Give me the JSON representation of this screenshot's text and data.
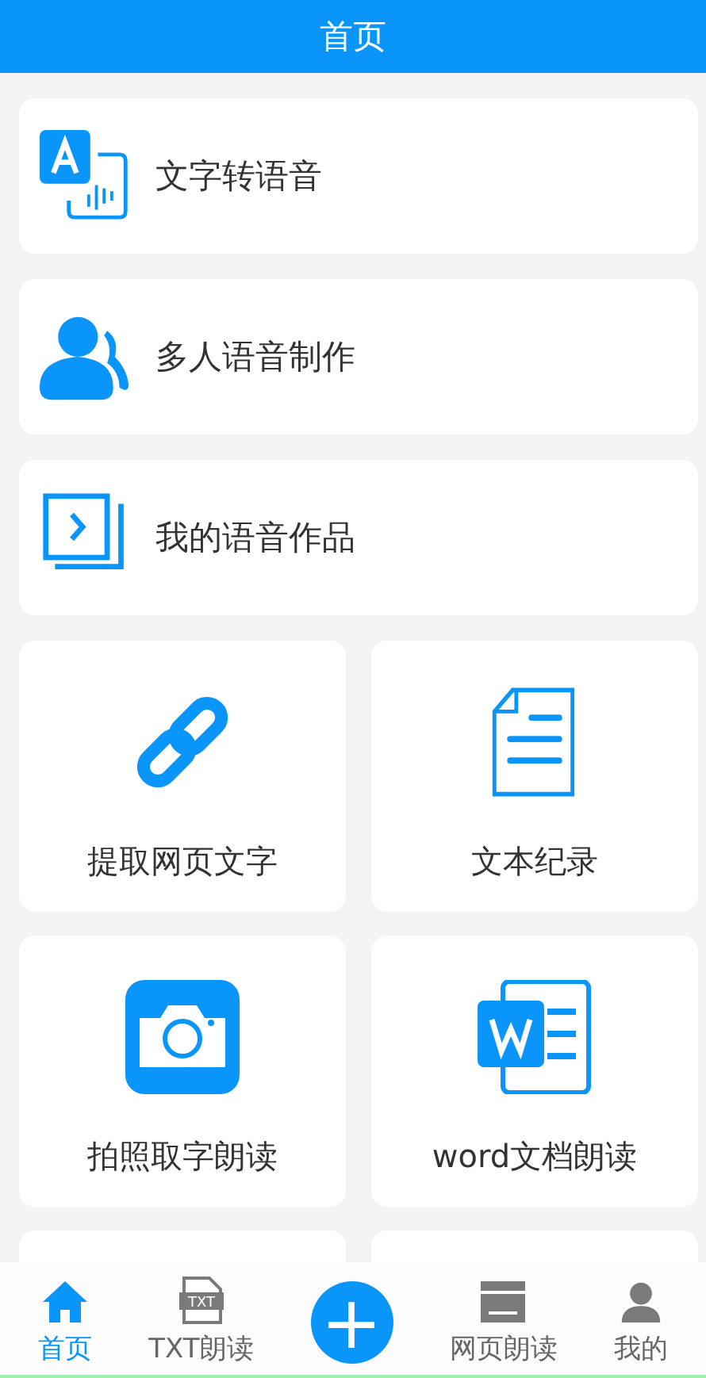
{
  "header": {
    "title": "首页"
  },
  "list_items": [
    {
      "label": "文字转语音"
    },
    {
      "label": "多人语音制作"
    },
    {
      "label": "我的语音作品"
    }
  ],
  "grid_items": [
    {
      "label": "提取网页文字"
    },
    {
      "label": "文本纪录"
    },
    {
      "label": "拍照取字朗读"
    },
    {
      "label": "word文档朗读"
    }
  ],
  "bottom_nav": [
    {
      "label": "首页",
      "selected": true
    },
    {
      "label": "TXT朗读",
      "selected": false,
      "icon_text": "TXT"
    },
    {
      "label": "网页朗读",
      "selected": false
    },
    {
      "label": "我的",
      "selected": false
    }
  ],
  "add_button": {
    "label": "+"
  }
}
